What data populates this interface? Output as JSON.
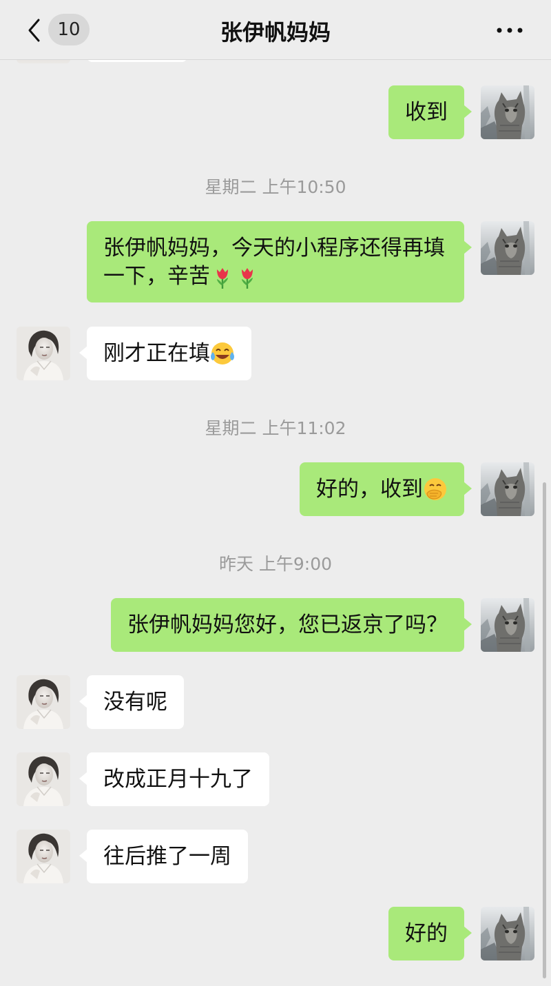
{
  "header": {
    "back_icon": "chevron-left-icon",
    "unread_count": "10",
    "title": "张伊帆妈妈",
    "more_icon": "more-dots-icon"
  },
  "avatars": {
    "me": "cat-photo-avatar",
    "peer": "woman-portrait-avatar"
  },
  "colors": {
    "background": "#ededed",
    "my_bubble": "#a9e97a",
    "peer_bubble": "#ffffff",
    "timestamp": "#9a9a9a"
  },
  "messages": [
    {
      "from": "me",
      "text": "收到"
    },
    {
      "type": "time",
      "text": "星期二 上午10:50"
    },
    {
      "from": "me",
      "text": "张伊帆妈妈，今天的小程序还得再填一下，辛苦",
      "emoji": "tulip-emoji x2"
    },
    {
      "from": "peer",
      "text": "刚才正在填",
      "emoji": "tears-of-joy-emoji"
    },
    {
      "type": "time",
      "text": "星期二 上午11:02"
    },
    {
      "from": "me",
      "text": "好的，收到",
      "emoji": "hand-over-mouth-emoji"
    },
    {
      "type": "time",
      "text": "昨天 上午9:00"
    },
    {
      "from": "me",
      "text": "张伊帆妈妈您好，您已返京了吗？"
    },
    {
      "from": "peer",
      "text": "没有呢"
    },
    {
      "from": "peer",
      "text": "改成正月十九了"
    },
    {
      "from": "peer",
      "text": "往后推了一周"
    },
    {
      "from": "me",
      "text": "好的"
    }
  ]
}
